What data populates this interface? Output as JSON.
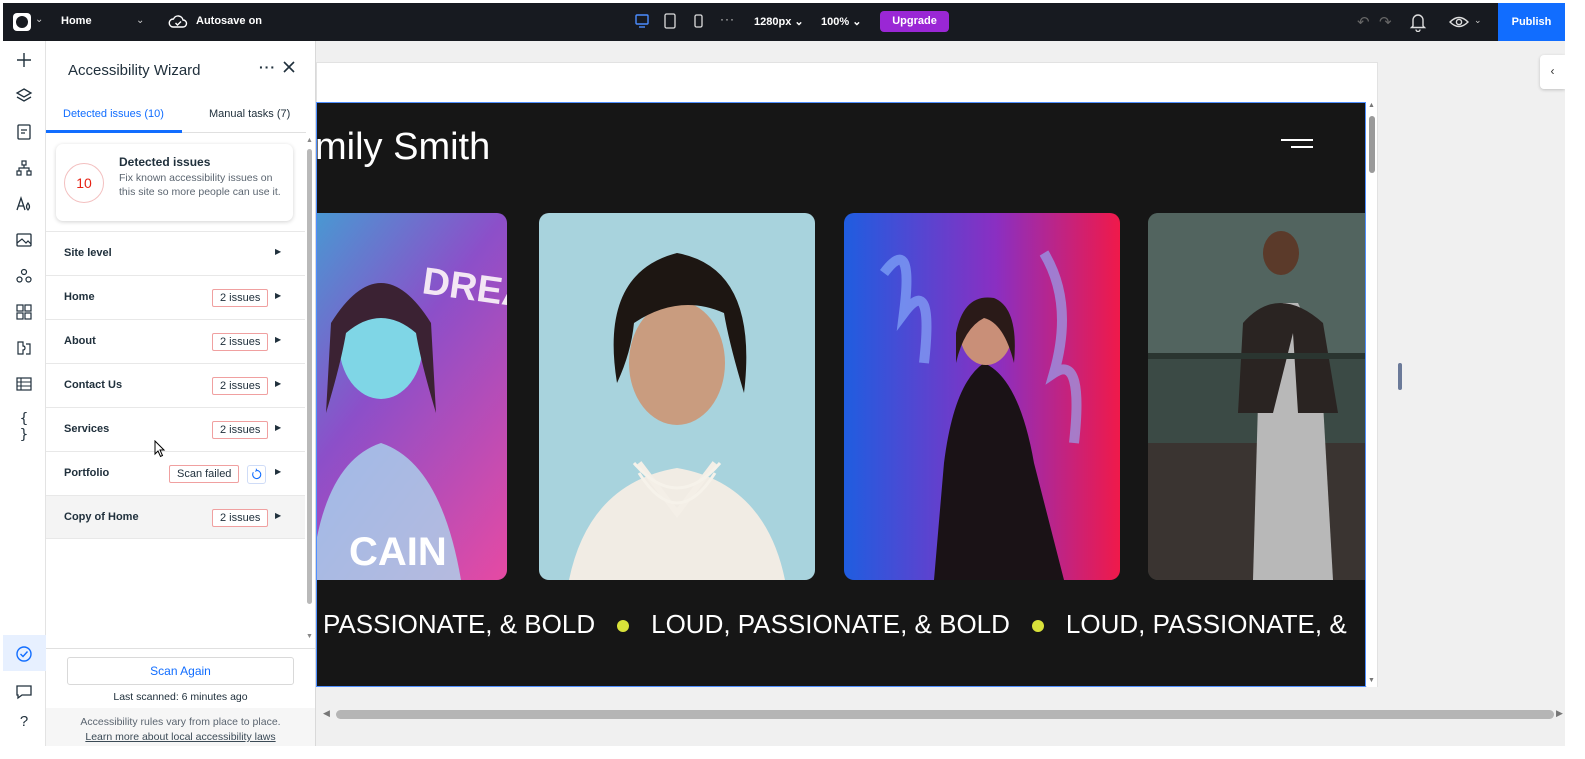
{
  "topbar": {
    "page_name": "Home",
    "autosave_label": "Autosave on",
    "more_label": "···",
    "canvas_width": "1280px ⌄",
    "zoom": "100% ⌄",
    "upgrade_label": "Upgrade",
    "publish_label": "Publish",
    "icons": [
      "wix-logo-icon",
      "cloud-check-icon",
      "desktop-icon",
      "tablet-icon",
      "mobile-icon",
      "undo-icon",
      "redo-icon",
      "bell-icon",
      "eye-icon"
    ]
  },
  "rail": {
    "icons": [
      "add-icon",
      "layers-icon",
      "pages-icon",
      "site-structure-icon",
      "design-icon",
      "media-icon",
      "apps-icon",
      "widgets-icon",
      "blocks-icon",
      "cms-table-icon",
      "code-icon",
      "accessibility-icon",
      "comments-icon",
      "help-icon"
    ]
  },
  "panel": {
    "title": "Accessibility Wizard",
    "more_label": "···",
    "tabs": [
      {
        "label": "Detected issues (10)",
        "active": true
      },
      {
        "label": "Manual tasks (7)",
        "active": false
      }
    ],
    "summary": {
      "count": "10",
      "title": "Detected issues",
      "description": "Fix known accessibility issues on this site so more people can use it."
    },
    "rows": [
      {
        "label": "Site level",
        "tag": "",
        "status": "none"
      },
      {
        "label": "Home",
        "tag": "2 issues",
        "status": "issues"
      },
      {
        "label": "About",
        "tag": "2 issues",
        "status": "issues"
      },
      {
        "label": "Contact Us",
        "tag": "2 issues",
        "status": "issues"
      },
      {
        "label": "Services",
        "tag": "2 issues",
        "status": "issues"
      },
      {
        "label": "Portfolio",
        "tag": "Scan failed",
        "status": "failed"
      },
      {
        "label": "Copy of Home",
        "tag": "2 issues",
        "status": "issues"
      }
    ],
    "scan_button": "Scan Again",
    "last_scanned": "Last scanned: 6 minutes ago",
    "note": "Accessibility rules vary from place to place.",
    "note_link": "Learn more about local accessibility laws"
  },
  "site": {
    "title": "mily Smith",
    "marquee": [
      "PASSIONATE, & BOLD",
      "LOUD, PASSIONATE, & BOLD",
      "LOUD, PASSIONATE, &"
    ],
    "photo_caption": "CAIN",
    "photo_text": "DREA",
    "accent_color": "#d9e23a"
  },
  "colors": {
    "topbar": "#171a20",
    "primary": "#116dff",
    "upgrade": "#9a27d5",
    "issue_border": "#f0a0a0"
  }
}
